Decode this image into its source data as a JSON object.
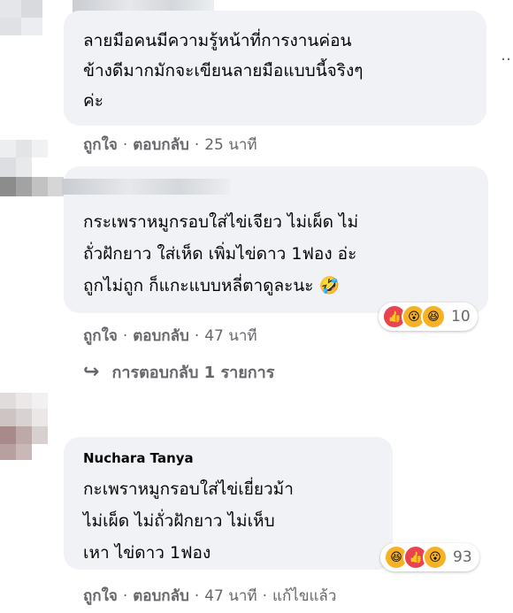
{
  "comments": [
    {
      "author": "",
      "lines": [
        "ลายมือคนมีความรู้หน้าที่การงานค่อน",
        "ข้างดีมากมักจะเขียนลายมือแบบนี้จริงๆ",
        "ค่ะ"
      ],
      "actions": {
        "like": "ถูกใจ",
        "reply": "ตอบกลับ",
        "time": "25 นาที",
        "edited": ""
      }
    },
    {
      "author": "",
      "lines": [
        "กระเพราหมูกรอบใส่ไข่เจียว ไม่เผ็ด ไม่",
        "ถั่วฝักยาว ใส่เห็ด เพิ่มไข่ดาว 1ฟอง อ่ะ",
        "ถูกไม่ถูก ก็แกะแบบหลี่ตาดูละนะ 🤣"
      ],
      "reactions": {
        "count": "10",
        "icons": [
          "like-icon",
          "wow-icon",
          "haha-icon"
        ]
      },
      "actions": {
        "like": "ถูกใจ",
        "reply": "ตอบกลับ",
        "time": "47 นาที",
        "edited": ""
      },
      "replies_label": "การตอบกลับ 1 รายการ"
    },
    {
      "author": "Nuchara Tanya",
      "lines": [
        "กะเพราหมูกรอบใส่ไข่เยี่ยวม้า",
        "ไม่เผ็ด ไม่ถั่วฝักยาว ไม่เห็บ",
        "เหา ไข่ดาว 1ฟอง"
      ],
      "reactions": {
        "count": "93",
        "icons": [
          "haha-icon",
          "like-icon",
          "wow-icon"
        ]
      },
      "actions": {
        "like": "ถูกใจ",
        "reply": "ตอบกลับ",
        "time": "47 นาที",
        "edited": "แก้ไขแล้ว"
      }
    }
  ],
  "colors": {
    "bubble": "#f0f2f5",
    "meta": "#65676b",
    "like": "#1877f2",
    "react_yellow": "#f7b125"
  }
}
